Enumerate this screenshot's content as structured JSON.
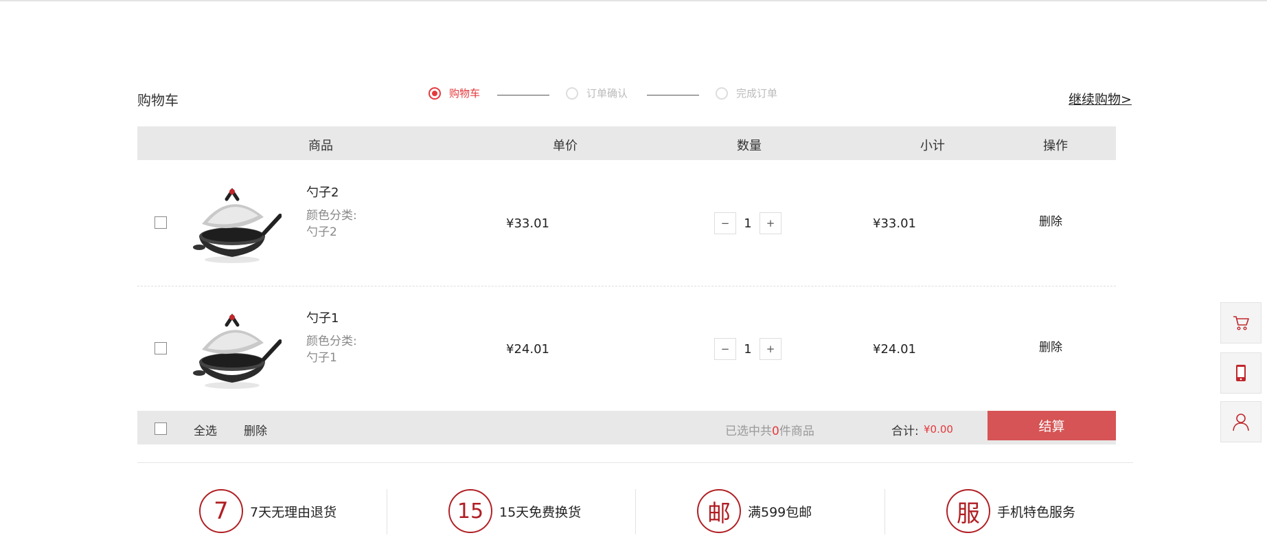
{
  "header": {
    "title": "购物车",
    "continue_label": "继续购物>"
  },
  "steps": [
    {
      "label": "购物车",
      "active": true
    },
    {
      "label": "订单确认",
      "active": false
    },
    {
      "label": "完成订单",
      "active": false
    }
  ],
  "table": {
    "headers": {
      "product": "商品",
      "unit_price": "单价",
      "quantity": "数量",
      "subtotal": "小计",
      "action": "操作"
    }
  },
  "items": [
    {
      "name": "勺子2",
      "attr_label": "颜色分类:",
      "attr_value": "勺子2",
      "price": "¥33.01",
      "qty": "1",
      "subtotal": "¥33.01",
      "delete_label": "删除",
      "minus": "−",
      "plus": "+"
    },
    {
      "name": "勺子1",
      "attr_label": "颜色分类:",
      "attr_value": "勺子1",
      "price": "¥24.01",
      "qty": "1",
      "subtotal": "¥24.01",
      "delete_label": "删除",
      "minus": "−",
      "plus": "+"
    }
  ],
  "footer": {
    "select_all": "全选",
    "delete": "删除",
    "count_prefix": "已选中共",
    "count": "0",
    "count_suffix": "件商品",
    "total_label": "合计:",
    "total_value": "¥0.00",
    "checkout": "结算"
  },
  "services": [
    {
      "icon_char": "7",
      "label": "7天无理由退货"
    },
    {
      "icon_char": "15",
      "label": "15天免费换货"
    },
    {
      "icon_char": "邮",
      "label": "满599包邮"
    },
    {
      "icon_char": "服",
      "label": "手机特色服务"
    }
  ],
  "side_toolbar": {
    "icons": [
      "cart-icon",
      "mobile-icon",
      "user-icon"
    ]
  },
  "colors": {
    "accent": "#e4393c",
    "checkout_bg": "#d65455",
    "service_red": "#b01e23",
    "table_head_bg": "#e8e8e8"
  }
}
